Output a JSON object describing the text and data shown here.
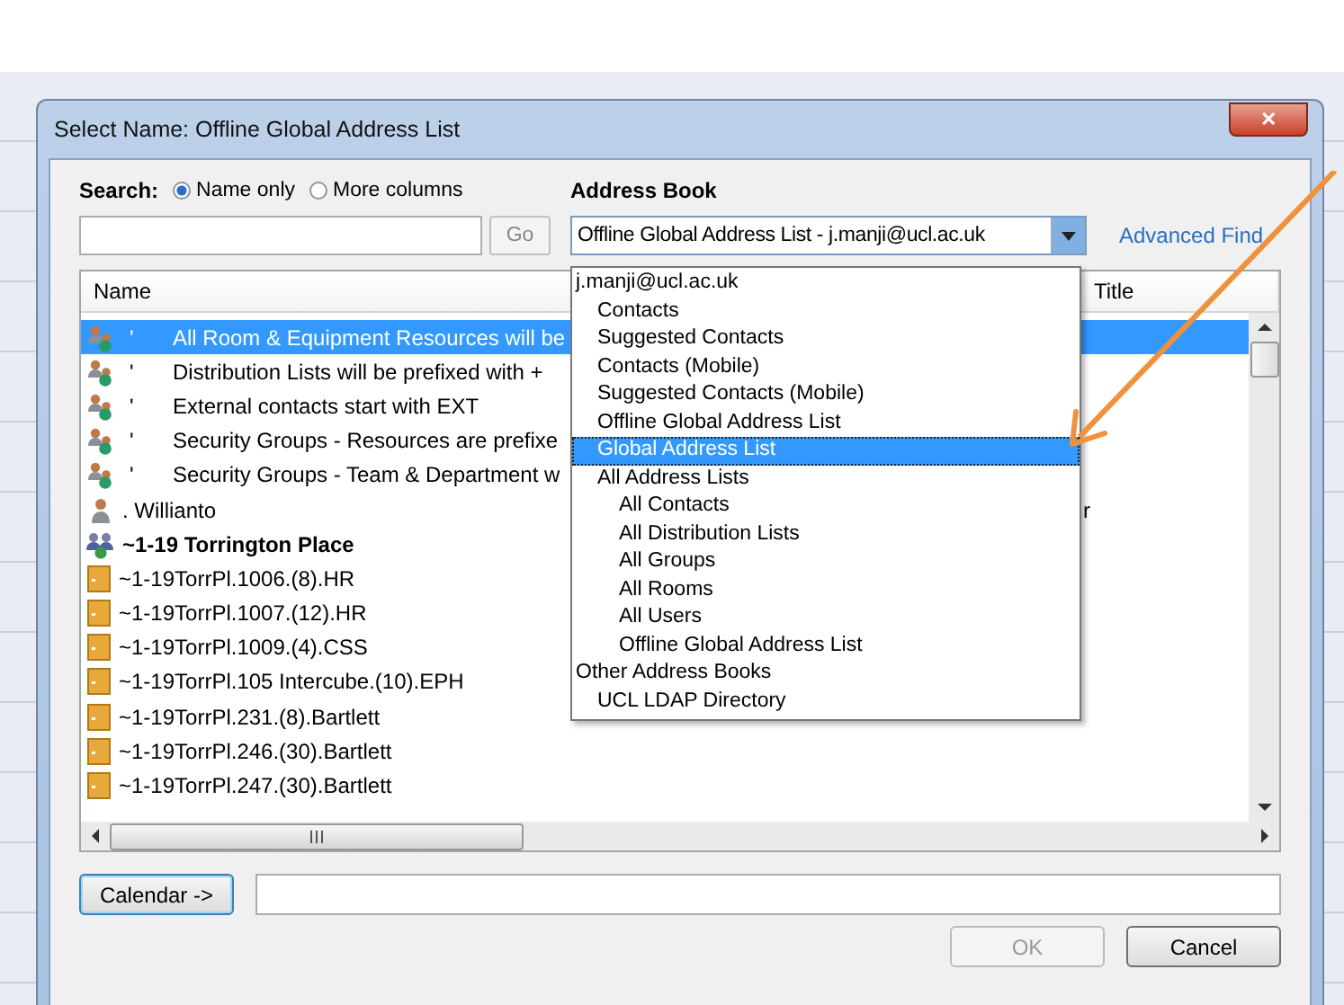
{
  "window": {
    "title": "Select Name: Offline Global Address List",
    "close": "✕"
  },
  "search": {
    "label": "Search:",
    "options": [
      {
        "label": "Name only",
        "selected": true
      },
      {
        "label": "More columns",
        "selected": false
      }
    ],
    "go": "Go"
  },
  "address_book": {
    "label": "Address Book",
    "value": "Offline Global Address List - j.manji@ucl.ac.uk",
    "advanced_find": "Advanced Find",
    "expanded": true
  },
  "dropdown": {
    "items": [
      {
        "label": "j.manji@ucl.ac.uk",
        "selected": false,
        "children": [
          {
            "label": "Contacts",
            "selected": false
          },
          {
            "label": "Suggested Contacts",
            "selected": false
          },
          {
            "label": "Contacts (Mobile)",
            "selected": false
          },
          {
            "label": "Suggested Contacts (Mobile)",
            "selected": false
          },
          {
            "label": "Offline Global Address List",
            "selected": false
          },
          {
            "label": "Global Address List",
            "selected": true
          },
          {
            "label": "All Address Lists",
            "selected": false,
            "children": [
              {
                "label": "All Contacts",
                "selected": false
              },
              {
                "label": "All Distribution Lists",
                "selected": false
              },
              {
                "label": "All Groups",
                "selected": false
              },
              {
                "label": "All Rooms",
                "selected": false
              },
              {
                "label": "All Users",
                "selected": false
              },
              {
                "label": "Offline Global Address List",
                "selected": false
              }
            ]
          }
        ]
      },
      {
        "label": "Other Address Books",
        "selected": false,
        "children": [
          {
            "label": "UCL LDAP Directory",
            "selected": false
          }
        ]
      }
    ]
  },
  "table": {
    "columns": [
      "Name",
      "Title"
    ],
    "rows": [
      {
        "kind": "group",
        "prefix": "'",
        "name": "All Room & Equipment Resources will be",
        "selected": true
      },
      {
        "kind": "group",
        "prefix": "'",
        "name": "Distribution Lists will be prefixed with +",
        "selected": false
      },
      {
        "kind": "group",
        "prefix": "'",
        "name": "External contacts start with EXT",
        "selected": false
      },
      {
        "kind": "group",
        "prefix": "'",
        "name": "Security Groups - Resources are prefixe",
        "selected": false
      },
      {
        "kind": "group",
        "prefix": "'",
        "name": "Security Groups - Team & Department w",
        "selected": false
      },
      {
        "kind": "person",
        "name": ". Willianto",
        "title": "r",
        "selected": false
      },
      {
        "kind": "building",
        "name": "~1-19 Torrington Place",
        "bold": true,
        "selected": false
      },
      {
        "kind": "room",
        "name": "~1-19TorrPl.1006.(8).HR",
        "selected": false
      },
      {
        "kind": "room",
        "name": "~1-19TorrPl.1007.(12).HR",
        "selected": false
      },
      {
        "kind": "room",
        "name": "~1-19TorrPl.1009.(4).CSS",
        "selected": false
      },
      {
        "kind": "room",
        "name": "~1-19TorrPl.105 Intercube.(10).EPH",
        "selected": false
      },
      {
        "kind": "room",
        "name": "~1-19TorrPl.231.(8).Bartlett",
        "selected": false
      },
      {
        "kind": "room",
        "name": "~1-19TorrPl.246.(30).Bartlett",
        "selected": false
      },
      {
        "kind": "room",
        "name": "~1-19TorrPl.247.(30).Bartlett",
        "selected": false
      }
    ]
  },
  "calendar_button": "Calendar ->",
  "buttons": [
    {
      "label": "OK",
      "disabled": true
    },
    {
      "label": "Cancel",
      "disabled": false
    }
  ]
}
